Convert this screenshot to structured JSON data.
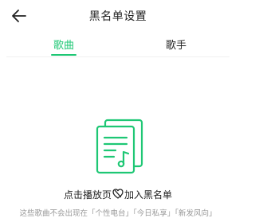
{
  "header": {
    "title": "黑名单设置",
    "back_icon": "arrow-left-icon"
  },
  "tabs": [
    {
      "label": "歌曲",
      "active": true
    },
    {
      "label": "歌手",
      "active": false
    }
  ],
  "empty_state": {
    "icon": "music-playlist-icon",
    "hint_prefix": "点击播放页",
    "hint_icon": "heart-slash-icon",
    "hint_suffix": "加入黑名单",
    "description": "这些歌曲不会出现在「个性电台」「今日私享」「新发风向」"
  },
  "colors": {
    "accent": "#1ec774",
    "text_primary": "#222222",
    "text_secondary": "#999999",
    "divider": "#f0f0f0"
  }
}
